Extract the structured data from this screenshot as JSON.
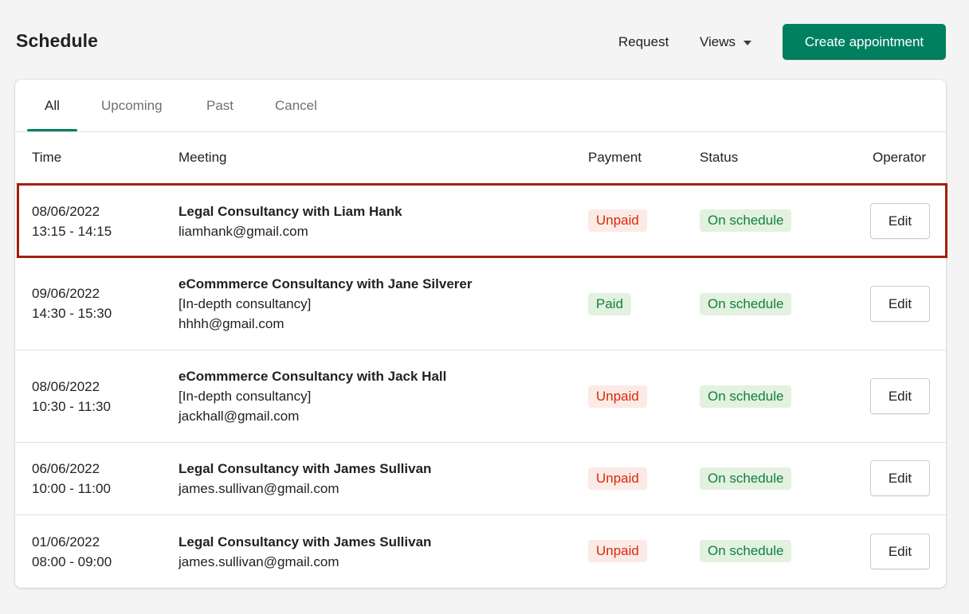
{
  "header": {
    "title": "Schedule",
    "request_label": "Request",
    "views_label": "Views",
    "create_label": "Create appointment",
    "primary_color": "#008060"
  },
  "tabs": [
    {
      "label": "All",
      "active": true
    },
    {
      "label": "Upcoming",
      "active": false
    },
    {
      "label": "Past",
      "active": false
    },
    {
      "label": "Cancel",
      "active": false
    }
  ],
  "table": {
    "columns": [
      "Time",
      "Meeting",
      "Payment",
      "Status",
      "Operator"
    ],
    "rows": [
      {
        "date": "08/06/2022",
        "time": "13:15 - 14:15",
        "title": "Legal Consultancy with Liam Hank",
        "detail": "",
        "email": "liamhank@gmail.com",
        "payment": "Unpaid",
        "status": "On schedule",
        "action": "Edit"
      },
      {
        "date": "09/06/2022",
        "time": "14:30 - 15:30",
        "title": "eCommmerce Consultancy with Jane Silverer",
        "detail": "[In-depth consultancy]",
        "email": "hhhh@gmail.com",
        "payment": "Paid",
        "status": "On schedule",
        "action": "Edit"
      },
      {
        "date": "08/06/2022",
        "time": "10:30 - 11:30",
        "title": "eCommmerce Consultancy with Jack Hall",
        "detail": "[In-depth consultancy]",
        "email": "jackhall@gmail.com",
        "payment": "Unpaid",
        "status": "On schedule",
        "action": "Edit"
      },
      {
        "date": "06/06/2022",
        "time": "10:00 - 11:00",
        "title": "Legal Consultancy with James Sullivan",
        "detail": "",
        "email": "james.sullivan@gmail.com",
        "payment": "Unpaid",
        "status": "On schedule",
        "action": "Edit"
      },
      {
        "date": "01/06/2022",
        "time": "08:00 - 09:00",
        "title": "Legal Consultancy with James Sullivan",
        "detail": "",
        "email": "james.sullivan@gmail.com",
        "payment": "Unpaid",
        "status": "On schedule",
        "action": "Edit"
      }
    ]
  },
  "colors": {
    "unpaid_bg": "#fbeae5",
    "unpaid_text": "#d72c0d",
    "paid_bg": "#e3f1df",
    "paid_text": "#108043",
    "highlight_border": "#a31f0e"
  }
}
